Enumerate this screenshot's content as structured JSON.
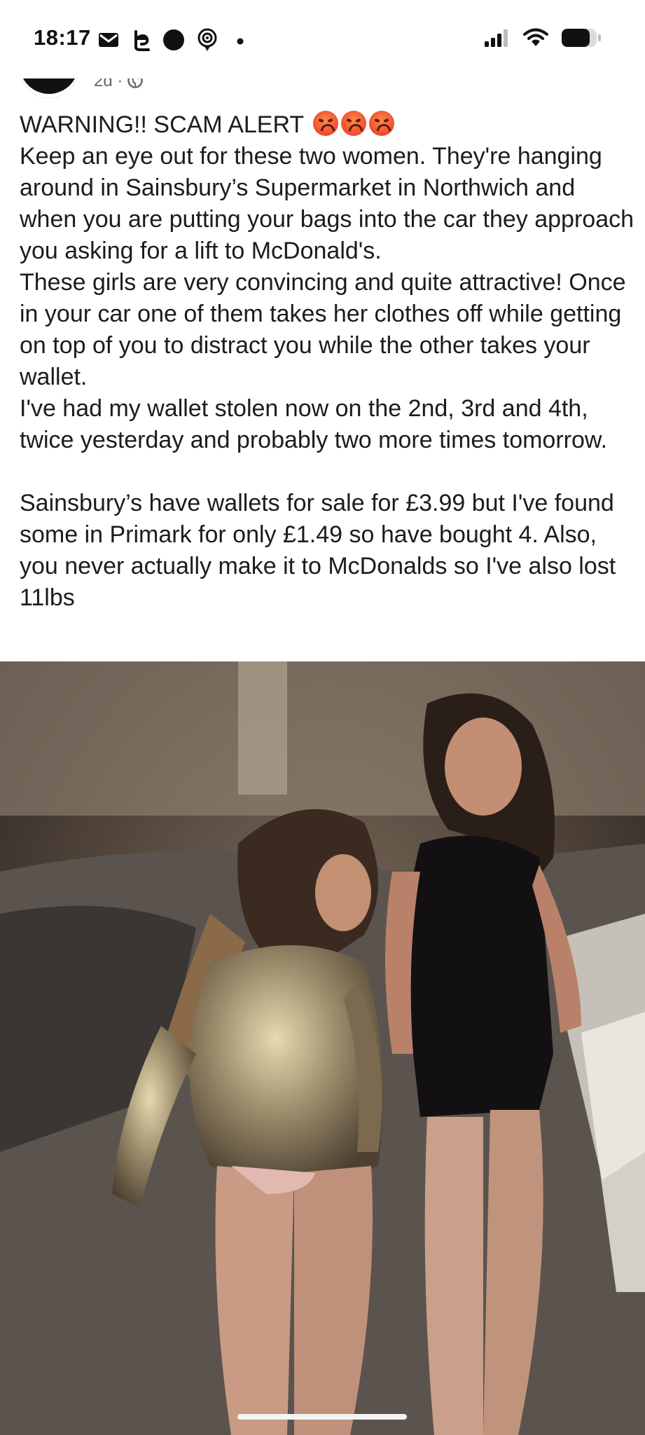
{
  "status_bar": {
    "time": "18:17",
    "left_icons": [
      "gmail-icon",
      "threads-icon",
      "dot-icon",
      "location-pin-icon",
      "more-dot-icon"
    ],
    "right_icons": [
      "signal-icon",
      "wifi-icon",
      "battery-icon"
    ]
  },
  "post": {
    "meta_time": "2d",
    "meta_separator": "·",
    "privacy_icon": "globe-icon",
    "title": "WARNING!! SCAM ALERT",
    "title_emoji": [
      "angry-face-emoji",
      "angry-face-emoji",
      "angry-face-emoji"
    ],
    "paragraphs": [
      "Keep an eye out for these two women. They're hanging around in Sainsbury’s Supermarket in Northwich and when you are putting your bags into the car they approach you asking for a lift to McDonald's.",
      "These girls are very convincing and quite attractive! Once in your car one of them takes her clothes off while getting on top of you to distract you while the other takes your wallet.",
      "I've had my wallet stolen now on the 2nd, 3rd and 4th, twice yesterday and probably two more times tomorrow.",
      "Sainsbury’s have wallets for sale for £3.99 but I've found some in Primark for only £1.49 so have bought 4. Also, you never actually make it to McDonalds so I've also lost 11lbs"
    ]
  },
  "photo": {
    "colors": {
      "background": "#4a3f38",
      "floor": "#5b544e",
      "wall": "#8a7d6e"
    }
  }
}
